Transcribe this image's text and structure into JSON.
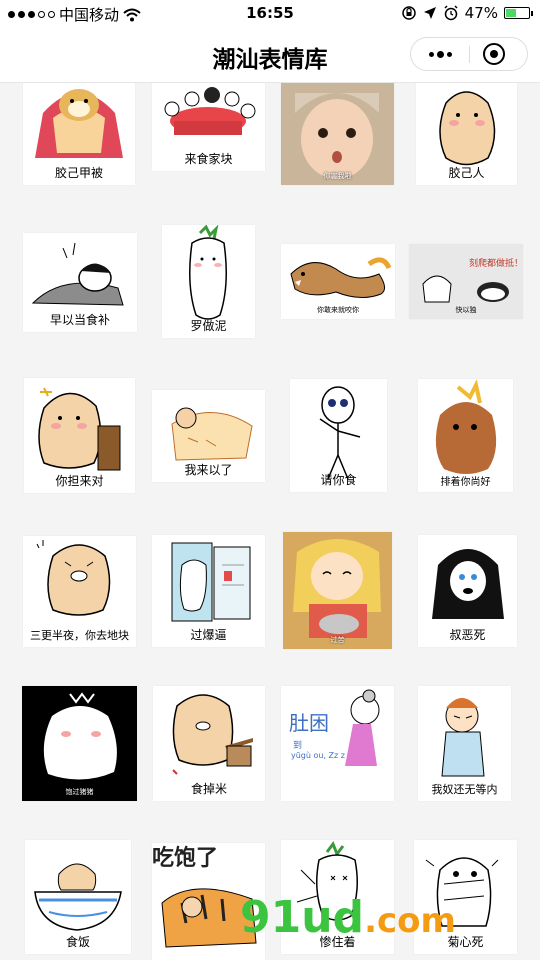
{
  "status_bar": {
    "carrier": "中国移动",
    "time": "16:55",
    "battery_percent": "47%",
    "battery_level": 0.47,
    "battery_color": "#4cd964"
  },
  "nav": {
    "title": "潮汕表情库",
    "more_icon": "more-dots-icon",
    "close_icon": "target-close-icon"
  },
  "stickers": [
    {
      "label": "胶己甲被"
    },
    {
      "label": "来食家块"
    },
    {
      "label": "你害我啦"
    },
    {
      "label": "胶己人"
    },
    {
      "label": "早以当食补"
    },
    {
      "label": "罗做泥"
    },
    {
      "label": "你敢来就咬你"
    },
    {
      "label": "快以独"
    },
    {
      "label": "你担来对"
    },
    {
      "label": "我来以了"
    },
    {
      "label": "请你食"
    },
    {
      "label": "排着你尚好"
    },
    {
      "label": "三更半夜，你去地块"
    },
    {
      "label": "过爆逼"
    },
    {
      "label": "过苦"
    },
    {
      "label": "叔恶死"
    },
    {
      "label": "饱过猪猪"
    },
    {
      "label": "食掉米"
    },
    {
      "label": "我奴还无等内"
    },
    {
      "label": "食饭"
    },
    {
      "label": "惨住着"
    },
    {
      "label": "菊心死"
    }
  ],
  "sticker_text": {
    "kicked": "刻爬都做抵！",
    "belly": "肚困",
    "belly_sub": "到",
    "belly_zzz": "yūgù ou, Zz z",
    "full": "吃饱了"
  },
  "watermark": {
    "main": "91ud",
    "domain": ".com"
  }
}
